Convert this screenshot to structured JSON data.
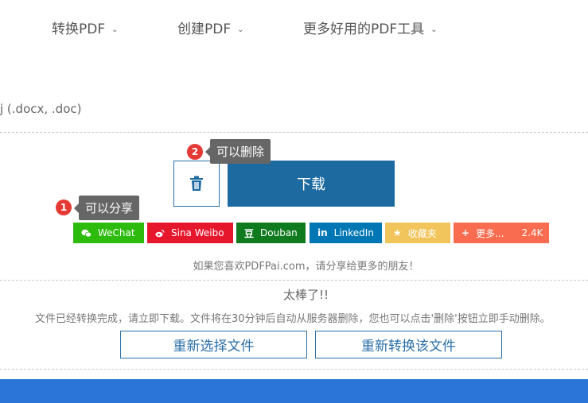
{
  "nav": {
    "items": [
      {
        "label": "转换PDF"
      },
      {
        "label": "创建PDF"
      },
      {
        "label": "更多好用的PDF工具"
      }
    ]
  },
  "file_type_text": "j (.docx, .doc)",
  "actions": {
    "download_label": "下载",
    "delete_icon": "trash-icon"
  },
  "tooltips": {
    "delete": {
      "badge": "2",
      "text": "可以删除"
    },
    "share": {
      "badge": "1",
      "text": "可以分享"
    }
  },
  "share": {
    "buttons": [
      {
        "icon": "wechat-icon",
        "glyph": "",
        "label": "WeChat",
        "color": "#2dbb0e"
      },
      {
        "icon": "weibo-icon",
        "glyph": "",
        "label": "Sina Weibo",
        "color": "#e6162d"
      },
      {
        "icon": "douban-icon",
        "glyph": "豆",
        "label": "Douban",
        "color": "#0f7a1e"
      },
      {
        "icon": "linkedin-icon",
        "glyph": "in",
        "label": "LinkedIn",
        "color": "#0077b5"
      },
      {
        "icon": "star-icon",
        "glyph": "★",
        "label": "收藏夹",
        "color": "#f2c55c"
      },
      {
        "icon": "plus-icon",
        "glyph": "+",
        "label": "更多...",
        "count": "2.4K",
        "color": "#fa6c4f"
      }
    ],
    "note": "如果您喜欢PDFPai.com，请分享给更多的朋友！"
  },
  "result": {
    "title": "太棒了!!",
    "info": "文件已经转换完成，请立即下载。文件将在30分钟后自动从服务器删除，您也可以点击'删除'按钮立即手动删除。",
    "reselect_label": "重新选择文件",
    "reconvert_label": "重新转换该文件"
  }
}
